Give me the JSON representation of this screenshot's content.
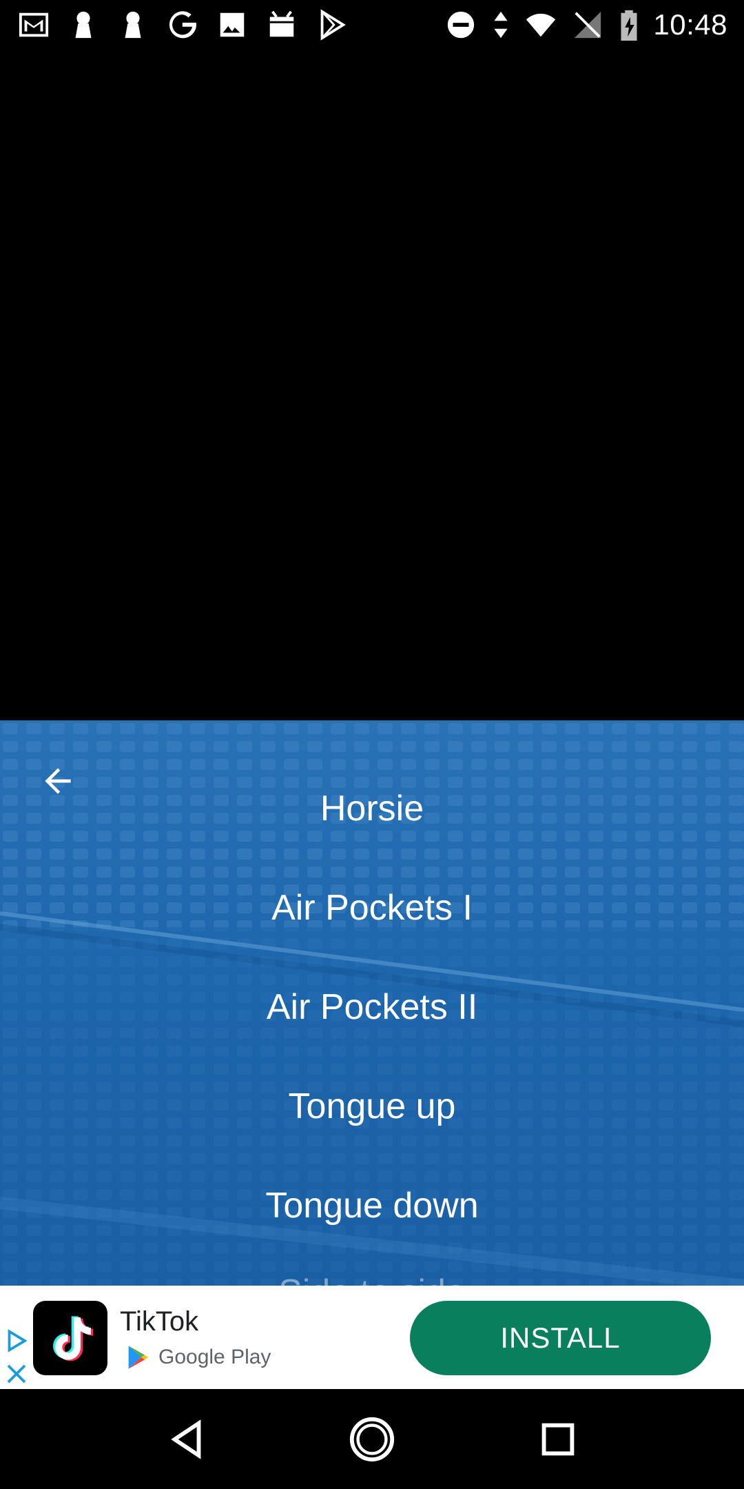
{
  "status_bar": {
    "time": "10:48",
    "left_icons": [
      "gmail-icon",
      "keyhole-icon",
      "keyhole-icon",
      "google-icon",
      "image-icon",
      "calendar-icon",
      "play-store-icon"
    ],
    "right_icons": [
      "do-not-disturb-icon",
      "data-arrows-icon",
      "wifi-icon",
      "no-signal-icon",
      "battery-charging-icon"
    ]
  },
  "menu": {
    "back_icon": "arrow-left-icon",
    "items": [
      {
        "label": "Horsie"
      },
      {
        "label": "Air Pockets I"
      },
      {
        "label": "Air Pockets II"
      },
      {
        "label": "Tongue up"
      },
      {
        "label": "Tongue down"
      },
      {
        "label": "Side to side"
      }
    ]
  },
  "ad": {
    "app_name": "TikTok",
    "store_name": "Google Play",
    "install_label": "INSTALL",
    "install_color": "#0a7f5e"
  },
  "nav": {
    "back": "back-icon",
    "home": "home-icon",
    "recents": "recents-icon"
  },
  "colors": {
    "menu_bg": "#1a63a8",
    "status_bg": "#000000"
  }
}
